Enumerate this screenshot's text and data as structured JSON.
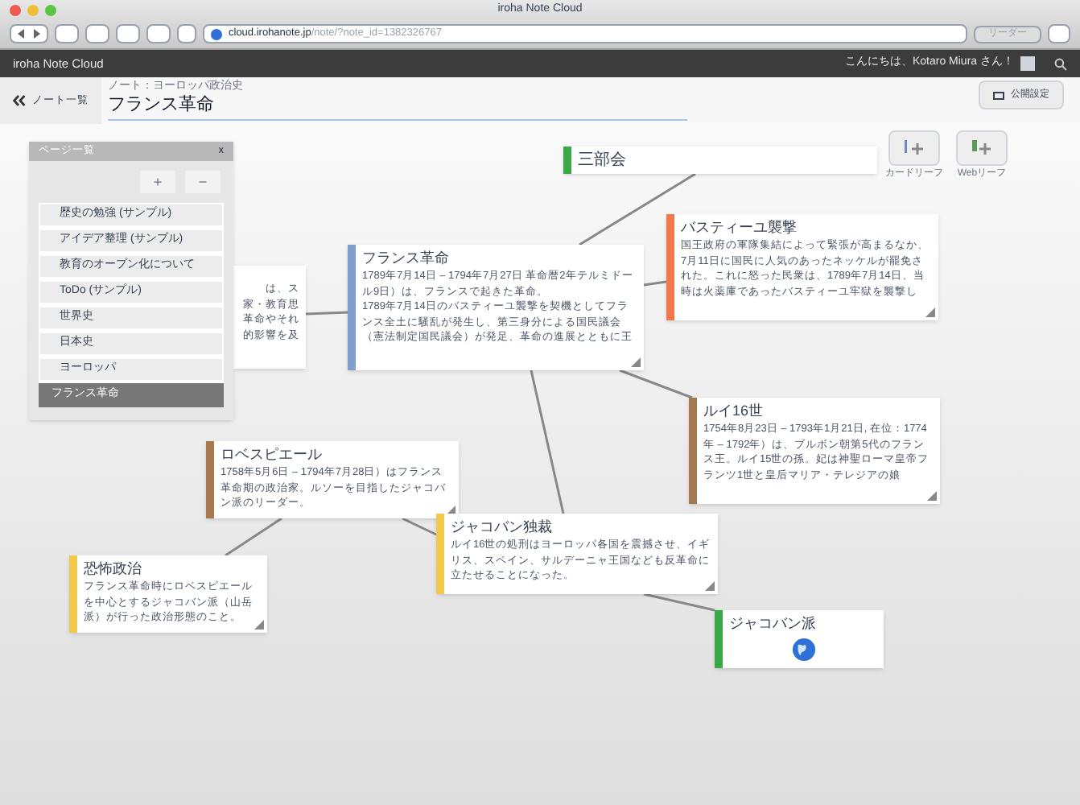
{
  "window": {
    "title": "iroha Note Cloud"
  },
  "browser": {
    "url_host": "cloud.irohanote.jp",
    "url_path": "/note/?note_id=1382326767",
    "reader_button": "リーダー"
  },
  "app_bar": {
    "brand": "iroha Note Cloud",
    "greeting": "こんにちは、Kotaro Miura さん！"
  },
  "header": {
    "back_button": "ノート一覧",
    "breadcrumb": "ノート：ヨーロッパ政治史",
    "title": "フランス革命",
    "publish_button": "公開設定"
  },
  "leaf_buttons": [
    {
      "label": "カードリーフ",
      "kind": "card"
    },
    {
      "label": "Webリーフ",
      "kind": "web"
    }
  ],
  "page_list": {
    "title": "ページ一覧",
    "close": "x",
    "add": "+",
    "remove": "−",
    "items": [
      {
        "label": "歴史の勉強 (サンプル)",
        "selected": false
      },
      {
        "label": "アイデア整理 (サンプル)",
        "selected": false
      },
      {
        "label": "教育のオープン化について",
        "selected": false
      },
      {
        "label": "ToDo (サンプル)",
        "selected": false
      },
      {
        "label": "世界史",
        "selected": false
      },
      {
        "label": "日本史",
        "selected": false
      },
      {
        "label": "ヨーロッパ",
        "selected": false
      },
      {
        "label": "フランス革命",
        "selected": true
      }
    ]
  },
  "cards": [
    {
      "kind": "text",
      "lines": [
        "は、ス",
        "家・教育思",
        "革命やそれ",
        "的影響を及"
      ]
    },
    {
      "kind": "title",
      "title": "三部会",
      "color": "#3aa845"
    },
    {
      "kind": "text",
      "title": "フランス革命",
      "lines": [
        "1789年7月14日 – 1794年7月27日 革命暦2年テルミドール9日）は、フランスで起きた革命。",
        "1789年7月14日のバスティーユ襲撃を契機としてフランス全土に騒乱が発生し、第三身分による国民議会（憲法制定国民議会）が発足、革命の進展とともに王"
      ],
      "color": "#7f9fcf"
    },
    {
      "kind": "text",
      "title": "バスティーユ襲撃",
      "lines": [
        "国王政府の軍隊集結によって緊張が高まるなか、7月11日に国民に人気のあったネッケルが罷免された。これに怒った民衆は、1789年7月14日、当時は火薬庫であったバスティーユ牢獄を襲撃し"
      ],
      "color": "#f0784a"
    },
    {
      "kind": "text",
      "title": "ルイ16世",
      "lines": [
        "1754年8月23日 – 1793年1月21日, 在位：1774年 – 1792年）は、ブルボン朝第5代のフランス王。ルイ15世の孫。妃は神聖ローマ皇帝フランツ1世と皇后マリア・テレジアの娘"
      ],
      "color": "#a57850"
    },
    {
      "kind": "text",
      "title": "ロベスピエール",
      "lines": [
        "1758年5月6日 – 1794年7月28日）はフランス革命期の政治家。ルソーを目指したジャコバン派のリーダー。"
      ],
      "color": "#a57850"
    },
    {
      "kind": "text",
      "title": "ジャコバン独裁",
      "lines": [
        "ルイ16世の処刑はヨーロッパ各国を震撼させ、イギリス、スペイン、サルデーニャ王国なども反革命に立たせることになった。"
      ],
      "color": "#f2c94c"
    },
    {
      "kind": "text",
      "title": "恐怖政治",
      "lines": [
        "フランス革命時にロベスピエールを中心とするジャコバン派（山岳派）が行った政治形態のこと。"
      ],
      "color": "#f2c94c"
    },
    {
      "kind": "web",
      "title": "ジャコバン派",
      "color": "#3aa845"
    }
  ]
}
